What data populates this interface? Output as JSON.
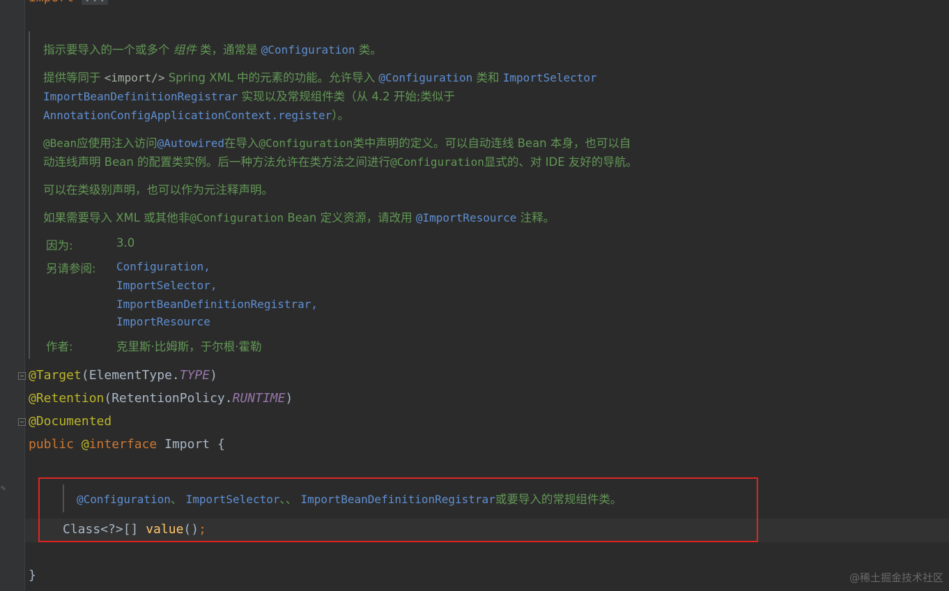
{
  "top_fold": {
    "keyword": "import",
    "ellipsis": "..."
  },
  "doc": {
    "p1": {
      "a": "指示要导入的一个或多个 ",
      "b": "组件",
      "c": " 类，通常是 ",
      "d": "@Configuration",
      "e": " 类。"
    },
    "p2": {
      "a": "提供等同于 ",
      "b": "<import/>",
      "c": " Spring XML 中的元素的功能。允许导入 ",
      "d": "@Configuration",
      "e": " 类和 ",
      "f": "ImportSelector",
      "g": "ImportBeanDefinitionRegistrar",
      "h": " 实现以及常规组件类（从 4.2 开始;类似于",
      "i": "AnnotationConfigApplicationContext.register",
      "j": "）。"
    },
    "p3": {
      "a": "@Bean",
      "b": "应使用注入访问",
      "c": "@Autowired",
      "d": "在导入",
      "e": "@Configuration",
      "f": "类中声明的定义。可以自动连线 Bean 本身，也可以自",
      "g": "动连线声明 Bean 的配置类实例。后一种方法允许在类方法之间进行",
      "h": "@Configuration",
      "i": "显式的、对 IDE 友好的导航。"
    },
    "p4": "可以在类级别声明，也可以作为元注释声明。",
    "p5": {
      "a": "如果需要导入 XML 或其他非",
      "b": "@Configuration",
      "c": " Bean 定义资源，请改用 ",
      "d": "@ImportResource",
      "e": " 注释。"
    }
  },
  "tags": {
    "since_label": "因为:",
    "since_value": "3.0",
    "see_label": "另请参阅:",
    "see_items": [
      "Configuration,",
      "ImportSelector,",
      "ImportBeanDefinitionRegistrar,",
      "ImportResource"
    ],
    "author_label": "作者:",
    "author_value": "克里斯·比姆斯，于尔根·霍勒"
  },
  "code": {
    "target": {
      "anno": "@Target",
      "open": "(ElementType.",
      "const": "TYPE",
      "close": ")"
    },
    "retention": {
      "anno": "@Retention",
      "open": "(RetentionPolicy.",
      "const": "RUNTIME",
      "close": ")"
    },
    "documented": "@Documented",
    "decl": {
      "public": "public",
      "at": "@",
      "interface": "interface",
      "name": " Import {"
    },
    "method_doc": {
      "a": "@Configuration",
      "b": "、 ",
      "c": "ImportSelector",
      "d": "、、 ",
      "e": "ImportBeanDefinitionRegistrar",
      "f": "或要导入的常规组件类。"
    },
    "method": {
      "type": "Class<?>[] ",
      "name": "value",
      "parens": "()",
      "semi": ";"
    },
    "closing": "}"
  },
  "watermark": "@稀土掘金技术社区",
  "colors": {
    "background": "#2b2b2b",
    "doc_text": "#629755",
    "keyword": "#cc7832",
    "annotation": "#bbb529",
    "link": "#5f8fd2",
    "highlight_border": "#e02424"
  }
}
